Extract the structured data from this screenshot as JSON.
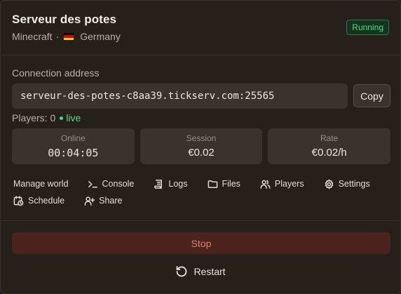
{
  "server": {
    "name": "Serveur des potes",
    "game": "Minecraft",
    "separator": "·",
    "region": "Germany",
    "status": "Running"
  },
  "connection": {
    "label": "Connection address",
    "address": "serveur-des-potes-c8aa39.tickserv.com:25565",
    "copy_label": "Copy"
  },
  "players": {
    "label": "Players: 0",
    "live_label": "live"
  },
  "stats": [
    {
      "label": "Online",
      "value": "00:04:05"
    },
    {
      "label": "Session",
      "value": "€0.02"
    },
    {
      "label": "Rate",
      "value": "€0.02/h"
    }
  ],
  "actions": {
    "manage_world": "Manage world",
    "console": "Console",
    "logs": "Logs",
    "files": "Files",
    "players": "Players",
    "settings": "Settings",
    "schedule": "Schedule",
    "share": "Share"
  },
  "buttons": {
    "stop": "Stop",
    "restart": "Restart"
  },
  "colors": {
    "accent_green": "#4ade80",
    "stop_red": "#f07a6b",
    "background": "#271f19"
  },
  "icons": [
    "flag-germany-icon",
    "terminal-icon",
    "scroll-icon",
    "folder-icon",
    "users-icon",
    "gear-icon",
    "calendar-clock-icon",
    "user-plus-icon",
    "rotate-ccw-icon"
  ]
}
